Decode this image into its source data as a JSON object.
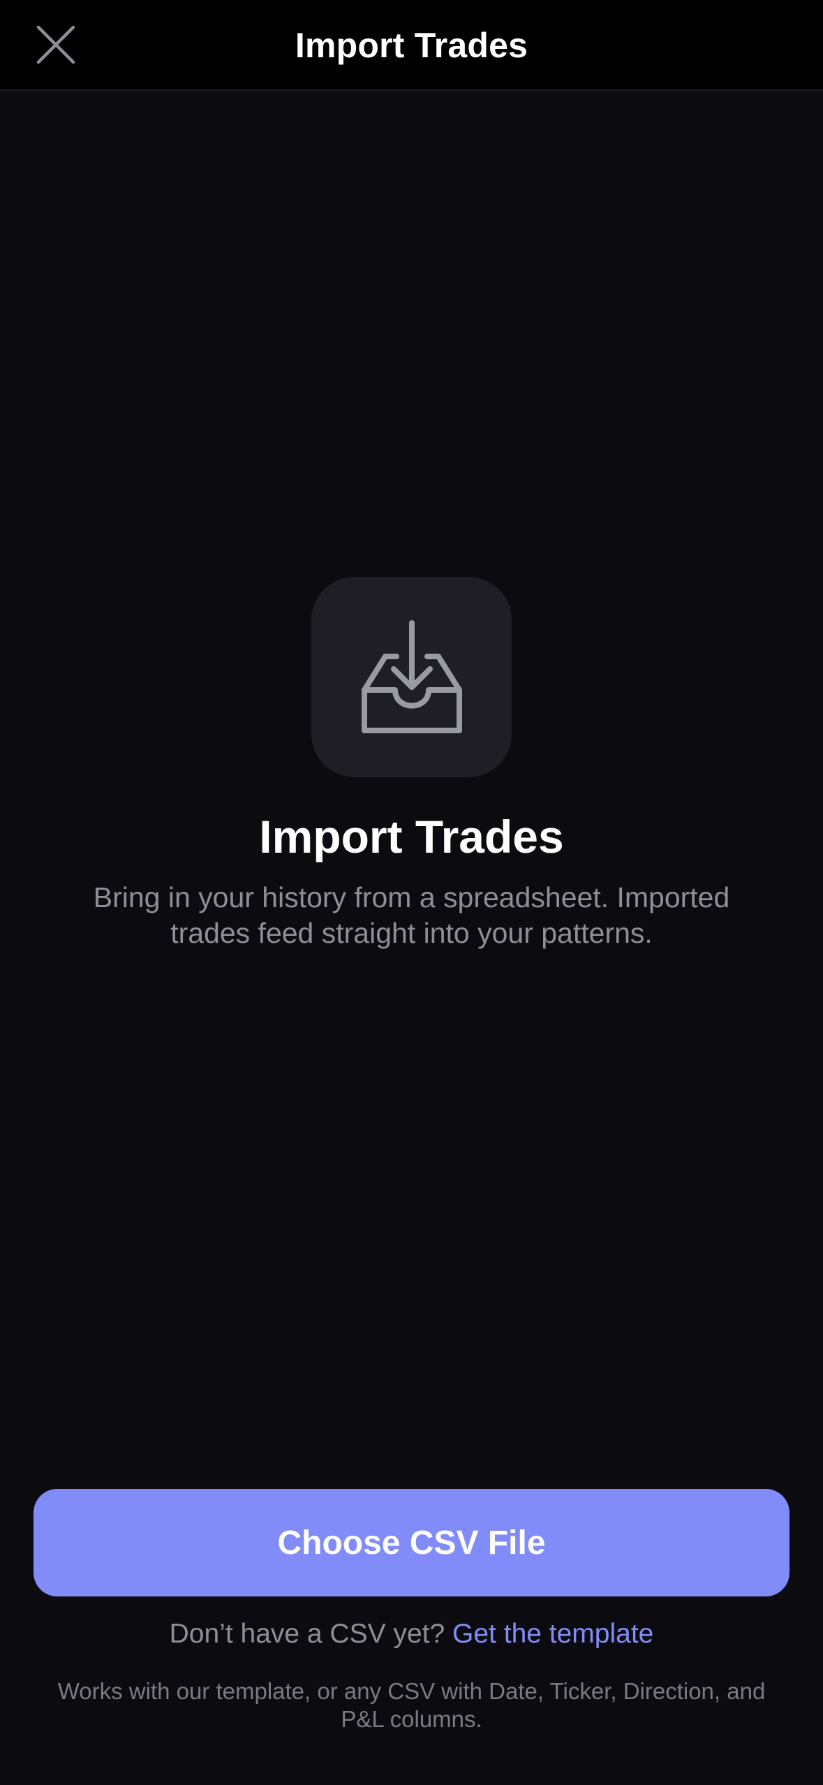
{
  "nav": {
    "title": "Import Trades",
    "close_icon": "close-icon"
  },
  "hero": {
    "icon": "inbox-download-icon",
    "title": "Import Trades",
    "subtitle": "Bring in your history from a spreadsheet. Imported trades feed straight into your patterns."
  },
  "cta": {
    "label": "Choose CSV File"
  },
  "template_prompt": {
    "text": "Don’t have a CSV yet?",
    "link": "Get the template"
  },
  "footnote": "Works with our template, or any CSV with Date, Ticker, Direction, and P&L columns.",
  "colors": {
    "accent": "#818cf8",
    "background": "#0c0c10",
    "nav_background": "#000000",
    "tile": "#1e1e24",
    "secondary_text": "#8e8e99"
  }
}
